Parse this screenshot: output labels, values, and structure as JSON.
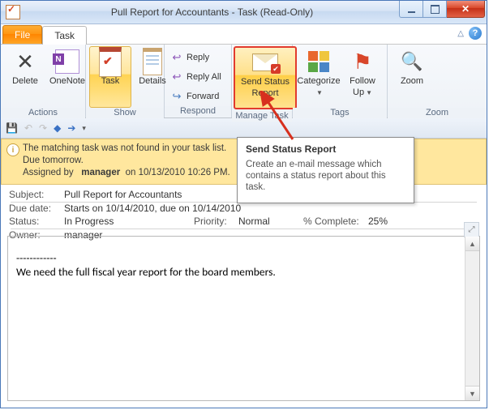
{
  "window": {
    "title": "Pull Report for Accountants  -  Task  (Read-Only)"
  },
  "tabs": {
    "file": "File",
    "task": "Task"
  },
  "ribbon": {
    "actions": {
      "label": "Actions",
      "delete": "Delete",
      "onenote": "OneNote"
    },
    "show": {
      "label": "Show",
      "task": "Task",
      "details": "Details"
    },
    "respond": {
      "label": "Respond",
      "reply": "Reply",
      "reply_all": "Reply All",
      "forward": "Forward"
    },
    "manage": {
      "label": "Manage Task",
      "send_status_line1": "Send Status",
      "send_status_line2": "Report"
    },
    "tags": {
      "label": "Tags",
      "categorize": "Categorize",
      "follow_line1": "Follow",
      "follow_line2": "Up"
    },
    "zoom": {
      "label": "Zoom",
      "zoom": "Zoom"
    }
  },
  "infobar": {
    "line1": "The matching task was not found in your task list.",
    "line2": "Due tomorrow.",
    "assigned_prefix": "Assigned by",
    "assigned_user": "manager",
    "assigned_suffix": "on 10/13/2010 10:26 PM."
  },
  "fields": {
    "subject_label": "Subject:",
    "subject": "Pull Report for Accountants",
    "due_label": "Due date:",
    "due": "Starts on 10/14/2010, due on 10/14/2010",
    "status_label": "Status:",
    "status": "In Progress",
    "priority_label": "Priority:",
    "priority": "Normal",
    "complete_label": "% Complete:",
    "complete": "25%",
    "owner_label": "Owner:",
    "owner": "manager"
  },
  "body": {
    "divider": "------------",
    "text": "We need the full fiscal year report for the board members."
  },
  "tooltip": {
    "title": "Send Status Report",
    "body": "Create an e-mail message which contains a status report about this task."
  }
}
